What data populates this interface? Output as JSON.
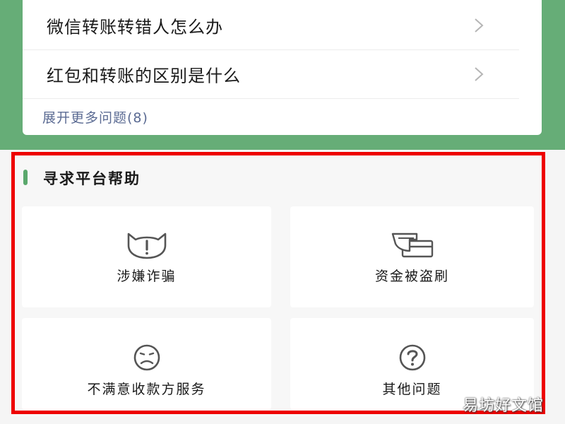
{
  "faq": {
    "items": [
      {
        "label": "微信转账转错人怎么办"
      },
      {
        "label": "红包和转账的区别是什么"
      }
    ],
    "expand_more": "展开更多问题(8)"
  },
  "help": {
    "title": "寻求平台帮助",
    "tiles": [
      {
        "label": "涉嫌诈骗",
        "icon": "cat-warning-icon"
      },
      {
        "label": "资金被盗刷",
        "icon": "card-swipe-icon"
      },
      {
        "label": "不满意收款方服务",
        "icon": "frown-face-icon"
      },
      {
        "label": "其他问题",
        "icon": "question-circle-icon"
      }
    ]
  },
  "colors": {
    "header_green": "#66ad77",
    "accent_green": "#5aa86c",
    "highlight_red": "#ee0000",
    "link_blue": "#5b6b93"
  },
  "watermark": "易坊好文馆"
}
